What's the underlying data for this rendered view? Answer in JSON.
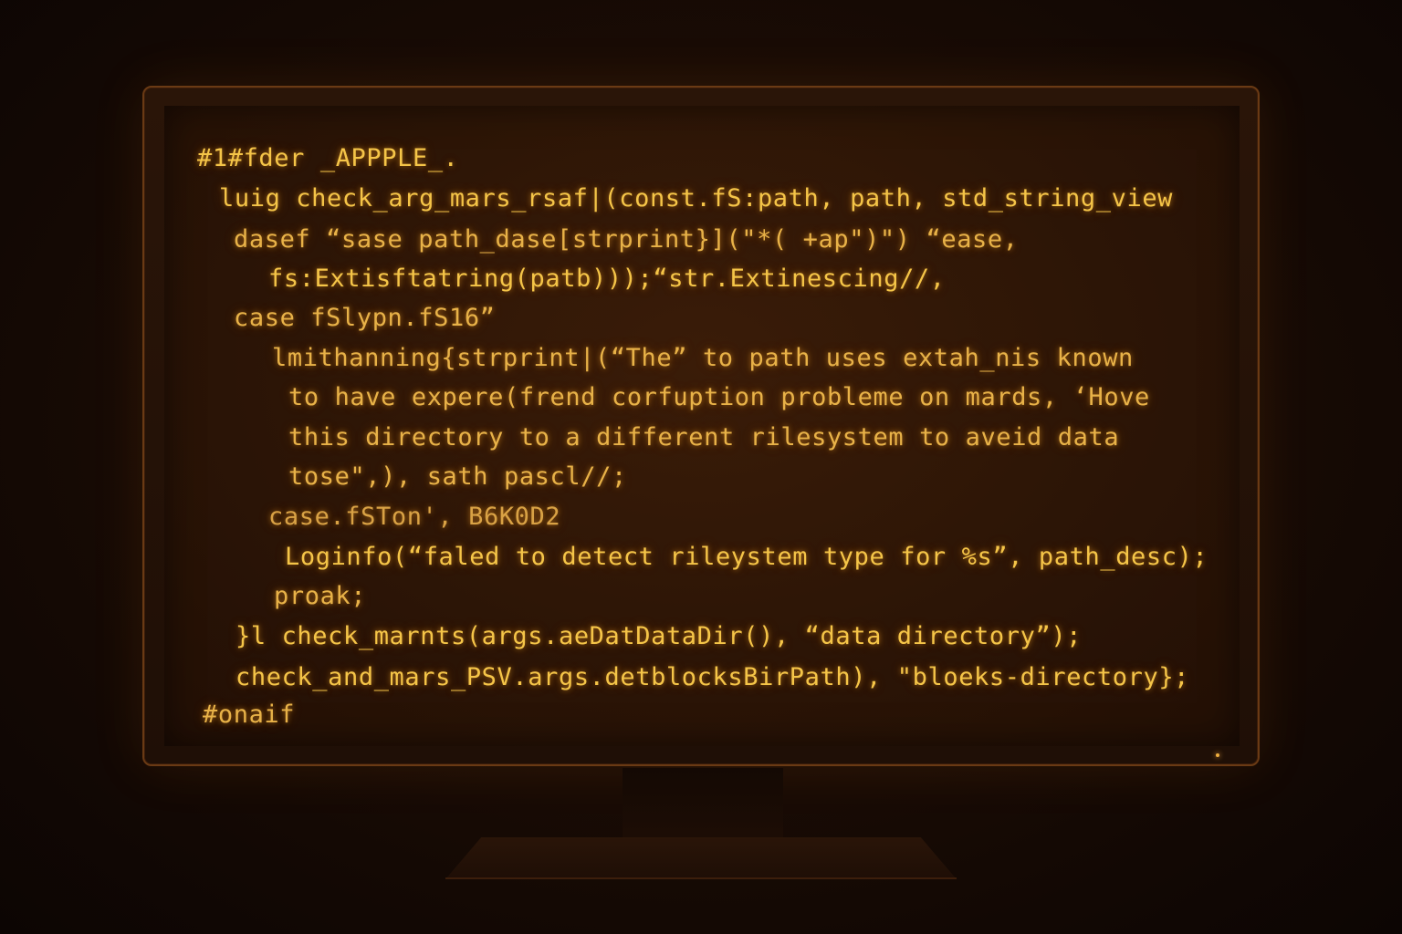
{
  "code_lines": [
    "#1#fder _APPPLE_.",
    "luig check_arg_mars_rsaf|(const.fS:path, path, std_string_view",
    "dasef “sase path_dase[strprint}](\"*( +ap\")\") “ease,",
    "fs:Extisftatring(patb)));“str.Extinescing//,",
    "case fSlypn.fS16”",
    "lmithanning{strprint|(“The” to path uses extah_nis known",
    "to have expere(frend corfuption probleme on mards, ‘Hove",
    "this directory to a different rilesystem to aveid data",
    "tose\",), sath pascl//;",
    "case.fSTon', B6K0D2",
    "Loginfo(“faled to detect rileystem type for %s”, path_desc);",
    "proak;",
    "}l check_marnts(args.aeDatDataDir(), “data directory”);",
    "check_and_mars_PSV.args.detblocksBirPath), \"bloeks-directory};",
    "#onaif"
  ],
  "colors": {
    "code_text": "#e8b248",
    "bright_text": "#f5c548",
    "screen_bg": "#2c1506",
    "bezel": "#6a3a14",
    "background": "#120804"
  }
}
